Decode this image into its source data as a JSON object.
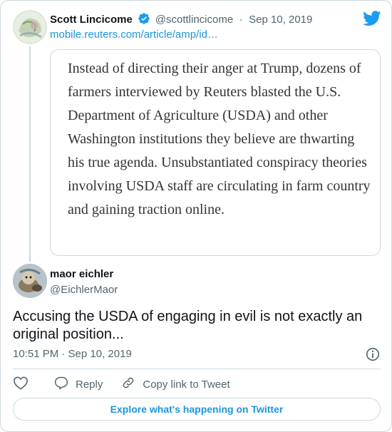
{
  "tweet_parent": {
    "author_name": "Scott Lincicome",
    "handle": "@scottlincicome",
    "separator": "·",
    "date": "Sep 10, 2019",
    "link_text": "mobile.reuters.com/article/amp/id…",
    "quote_text": "Instead of directing their anger at Trump, dozens of farmers interviewed by Reuters blasted the U.S. Department of Agriculture (USDA) and other Washington institutions they believe are thwarting his true agenda. Unsubstantiated conspiracy theories involving USDA staff are circulating in farm country and gaining traction online."
  },
  "tweet_main": {
    "author_name": "maor eichler",
    "handle": "@EichlerMaor",
    "text": "Accusing the USDA of engaging in evil is not exactly an original position...",
    "timestamp": "10:51 PM · Sep 10, 2019"
  },
  "actions": {
    "like_icon": "heart-icon",
    "reply_label": "Reply",
    "copy_label": "Copy link to Tweet"
  },
  "footer": {
    "explore_label": "Explore what's happening on Twitter"
  },
  "colors": {
    "accent": "#1b95e0",
    "verified": "#1d9bf0",
    "border": "#cfd9de",
    "muted": "#536471"
  }
}
